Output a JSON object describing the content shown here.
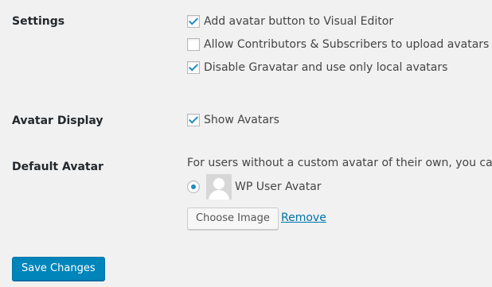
{
  "settings": {
    "label": "Settings",
    "options": [
      {
        "label": "Add avatar button to Visual Editor",
        "checked": true
      },
      {
        "label": "Allow Contributors & Subscribers to upload avatars",
        "checked": false
      },
      {
        "label": "Disable Gravatar and use only local avatars",
        "checked": true
      }
    ]
  },
  "avatar_display": {
    "label": "Avatar Display",
    "option": {
      "label": "Show Avatars",
      "checked": true
    }
  },
  "default_avatar": {
    "label": "Default Avatar",
    "description": "For users without a custom avatar of their own, you can eit",
    "choice": {
      "label": "WP User Avatar",
      "selected": true
    },
    "choose_image_label": "Choose Image",
    "remove_label": "Remove"
  },
  "footer": {
    "save_label": "Save Changes"
  },
  "colors": {
    "accent": "#0085ba",
    "link": "#0073aa",
    "background": "#f1f1f1"
  }
}
